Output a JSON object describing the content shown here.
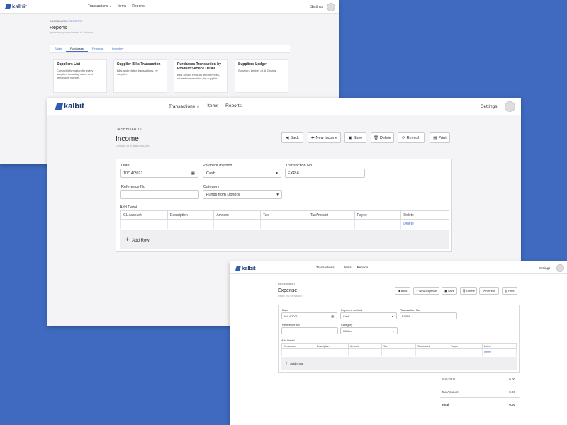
{
  "brand": {
    "name": "kalbit"
  },
  "nav": {
    "transactions": "Transactions",
    "items": "Items",
    "reports": "Reports",
    "settings": "Settings"
  },
  "reports_window": {
    "breadcrumb_root": "DASHBOARD",
    "breadcrumb_current": "REPORTS",
    "title": "Reports",
    "subtitle": "generate any report related to Software",
    "tabs": [
      "Sales",
      "Purchases",
      "Financial",
      "Inventory"
    ],
    "cards": [
      {
        "title": "Suppliers List",
        "desc": "Contact information for every supplier, including name and telephone number."
      },
      {
        "title": "Supplier Bills Transaction",
        "desc": "Bills and related transactions, by supplier."
      },
      {
        "title": "Purchases Transaction by Product/Service Detail",
        "desc": "Bills Detail, Product and Services, related transactions, by supplier."
      },
      {
        "title": "Suppliers Ledger",
        "desc": "Suppliers Ledger of All Details."
      }
    ]
  },
  "income_window": {
    "breadcrumb": "DASHBOARD",
    "title": "Income",
    "subtitle": "create any transaction",
    "actions": {
      "back": "Back",
      "new": "New Income",
      "save": "Save",
      "delete": "Delete",
      "refresh": "Refresh",
      "print": "Print"
    },
    "form": {
      "date_label": "Date",
      "date_value": "10/14/2021",
      "payment_label": "Payment method",
      "payment_value": "Cash",
      "txn_label": "Transaction No",
      "txn_value": "EXP-6",
      "ref_label": "Reference No",
      "ref_value": "",
      "category_label": "Category",
      "category_value": "Funds from Donors"
    },
    "detail_label": "Add Detail",
    "columns": [
      "GL Account",
      "Description",
      "Amount",
      "Tax",
      "TaxAmount",
      "Payee",
      "Delete"
    ],
    "row_delete": "Delete",
    "add_row": "Add Row"
  },
  "expense_window": {
    "breadcrumb": "DASHBOARD",
    "title": "Expense",
    "subtitle": "create any transaction",
    "actions": {
      "back": "Back",
      "new": "New Expense",
      "save": "Save",
      "delete": "Delete",
      "refresh": "Refresh",
      "print": "Print"
    },
    "form": {
      "date_label": "Date",
      "date_value": "10/14/2021",
      "payment_label": "Payment method",
      "payment_value": "Cash",
      "txn_label": "Transaction No",
      "txn_value": "EXP-6",
      "ref_label": "Reference No",
      "ref_value": "",
      "category_label": "Category",
      "category_value": "Utilities"
    },
    "detail_label": "Add Detail",
    "columns": [
      "GL Account",
      "Description",
      "Amount",
      "Tax",
      "TaxAmount",
      "Payee",
      "Delete"
    ],
    "row_delete": "Delete",
    "add_row": "Add Row",
    "totals": [
      {
        "label": "Sub-Total",
        "value": "0.00"
      },
      {
        "label": "Tax Amount",
        "value": "0.00"
      },
      {
        "label": "Total",
        "value": "0.00"
      }
    ]
  }
}
